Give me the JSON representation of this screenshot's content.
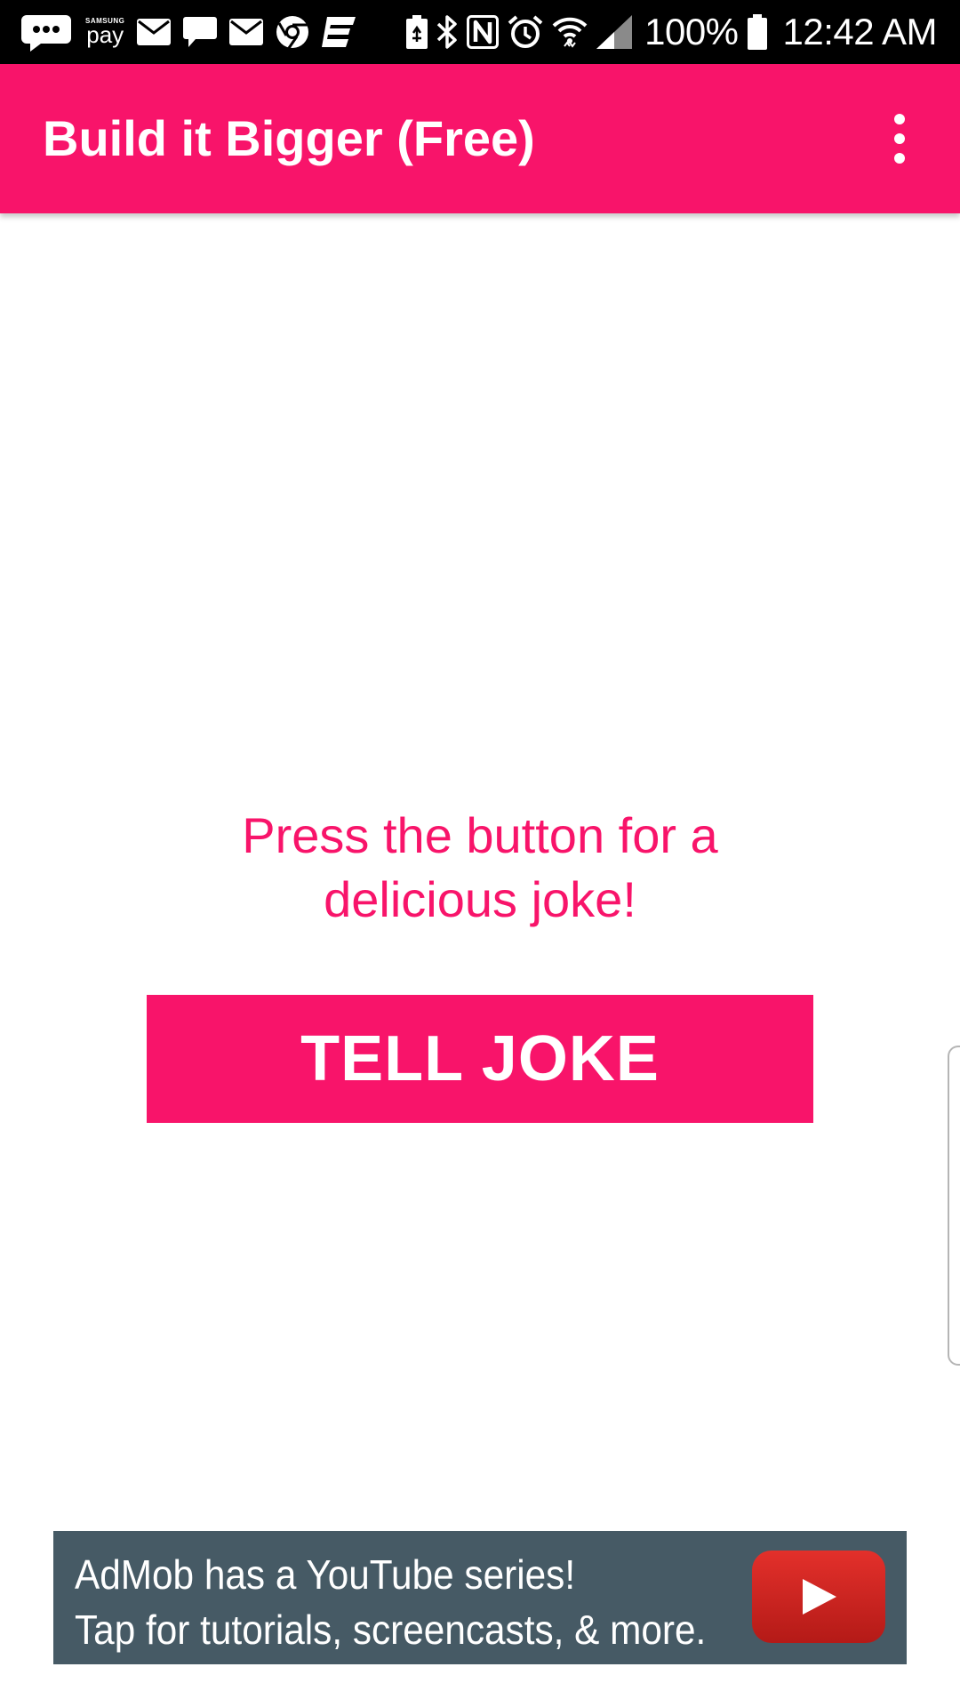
{
  "status_bar": {
    "icons_left": [
      "messages-icon",
      "samsung-pay-icon",
      "email-icon",
      "chat-icon",
      "email-icon",
      "chrome-icon",
      "app-icon"
    ],
    "icons_right": [
      "battery-saver-icon",
      "bluetooth-icon",
      "nfc-icon",
      "alarm-icon",
      "wifi-icon",
      "signal-icon",
      "battery-icon"
    ],
    "samsung_pay_brand": "SAMSUNG",
    "samsung_pay_label": "pay",
    "battery_percent": "100%",
    "time": "12:42 AM"
  },
  "app_bar": {
    "title": "Build it Bigger (Free)",
    "menu_icon": "more-vert-icon"
  },
  "main": {
    "instructions_line1": "Press the button for a",
    "instructions_line2": "delicious joke!",
    "button_label": "TELL JOKE"
  },
  "ad": {
    "line1": "AdMob has a YouTube series!",
    "line2": "Tap for tutorials, screencasts, & more.",
    "logo_icon": "youtube-play-icon"
  },
  "colors": {
    "accent": "#f8146a",
    "status_bar": "#000000",
    "ad_background": "#465a65",
    "youtube_red": "#e3302b"
  }
}
